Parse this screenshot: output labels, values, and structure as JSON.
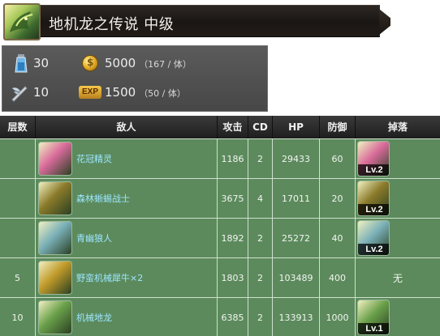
{
  "header": {
    "title": "地机龙之传说 中级",
    "icon": "green-dragon-icon"
  },
  "stats": {
    "stamina": {
      "icon": "stamina-potion-icon",
      "value": "30"
    },
    "gold": {
      "icon": "gold-coin-icon",
      "value": "5000",
      "per": "（167 / 体）"
    },
    "keys": {
      "icon": "winged-sword-icon",
      "value": "10"
    },
    "exp": {
      "icon": "exp-badge-icon",
      "label": "EXP",
      "value": "1500",
      "per": "（50 / 体）"
    }
  },
  "table": {
    "headers": [
      "层数",
      "敌人",
      "攻击",
      "CD",
      "HP",
      "防御",
      "掉落"
    ],
    "rows": [
      {
        "floor": "",
        "name": "花冠精灵",
        "attack": "1186",
        "cd": "2",
        "hp": "29433",
        "defense": "60",
        "drop": "Lv.2",
        "portrait_color": "#d86a9a"
      },
      {
        "floor": "",
        "name": "森林蜥蜴战士",
        "attack": "3675",
        "cd": "4",
        "hp": "17011",
        "defense": "20",
        "drop": "Lv.2",
        "portrait_color": "#8a7a2a"
      },
      {
        "floor": "",
        "name": "青幽狼人",
        "attack": "1892",
        "cd": "2",
        "hp": "25272",
        "defense": "40",
        "drop": "Lv.2",
        "portrait_color": "#7ab0b8"
      },
      {
        "floor": "5",
        "name": "野蛮机械犀牛×2",
        "attack": "1803",
        "cd": "2",
        "hp": "103489",
        "defense": "400",
        "drop": "无",
        "portrait_color": "#c09a2a"
      },
      {
        "floor": "10",
        "name": "机械地龙",
        "attack": "6385",
        "cd": "2",
        "hp": "133913",
        "defense": "1000",
        "drop": "Lv.1",
        "portrait_color": "#6aa04a"
      }
    ]
  },
  "colors": {
    "row_bg": "#5c8a5c",
    "header_bg": "#1e1e1e",
    "name_text": "#9de6ff"
  }
}
